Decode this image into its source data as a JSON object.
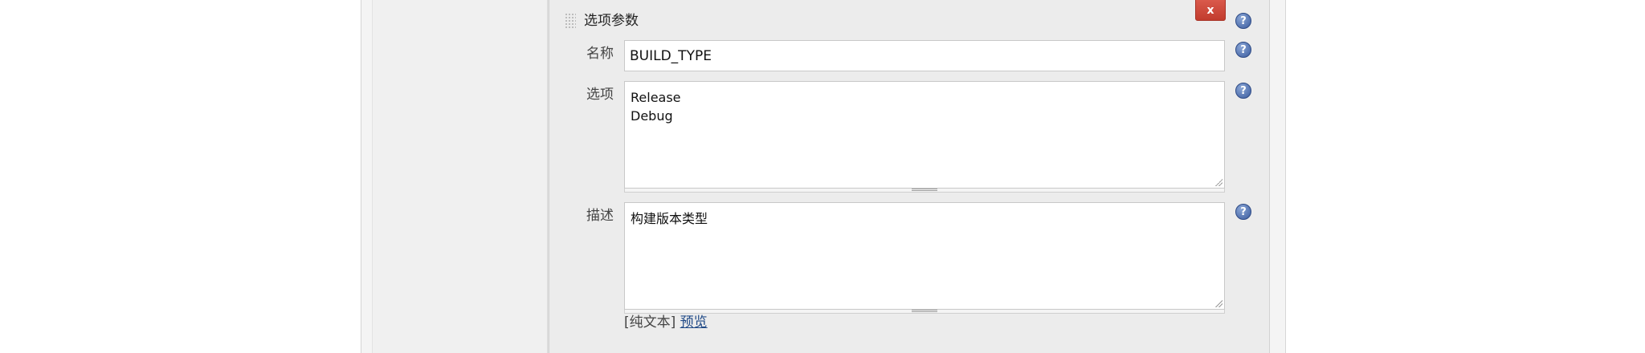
{
  "section": {
    "title": "选项参数",
    "delete_label": "x",
    "help_label": "?"
  },
  "fields": {
    "name": {
      "label": "名称",
      "value": "BUILD_TYPE"
    },
    "choices": {
      "label": "选项",
      "value": "Release\nDebug"
    },
    "description": {
      "label": "描述",
      "value": "构建版本类型"
    }
  },
  "format": {
    "plain_text": "[纯文本]",
    "preview": "预览"
  },
  "colors": {
    "delete_button": "#c9473a",
    "help_icon": "#3b5c9e",
    "link": "#204a87"
  },
  "icons": {
    "drag": "drag-handle-icon",
    "help": "question-mark-icon",
    "resize": "resize-grip-icon"
  }
}
